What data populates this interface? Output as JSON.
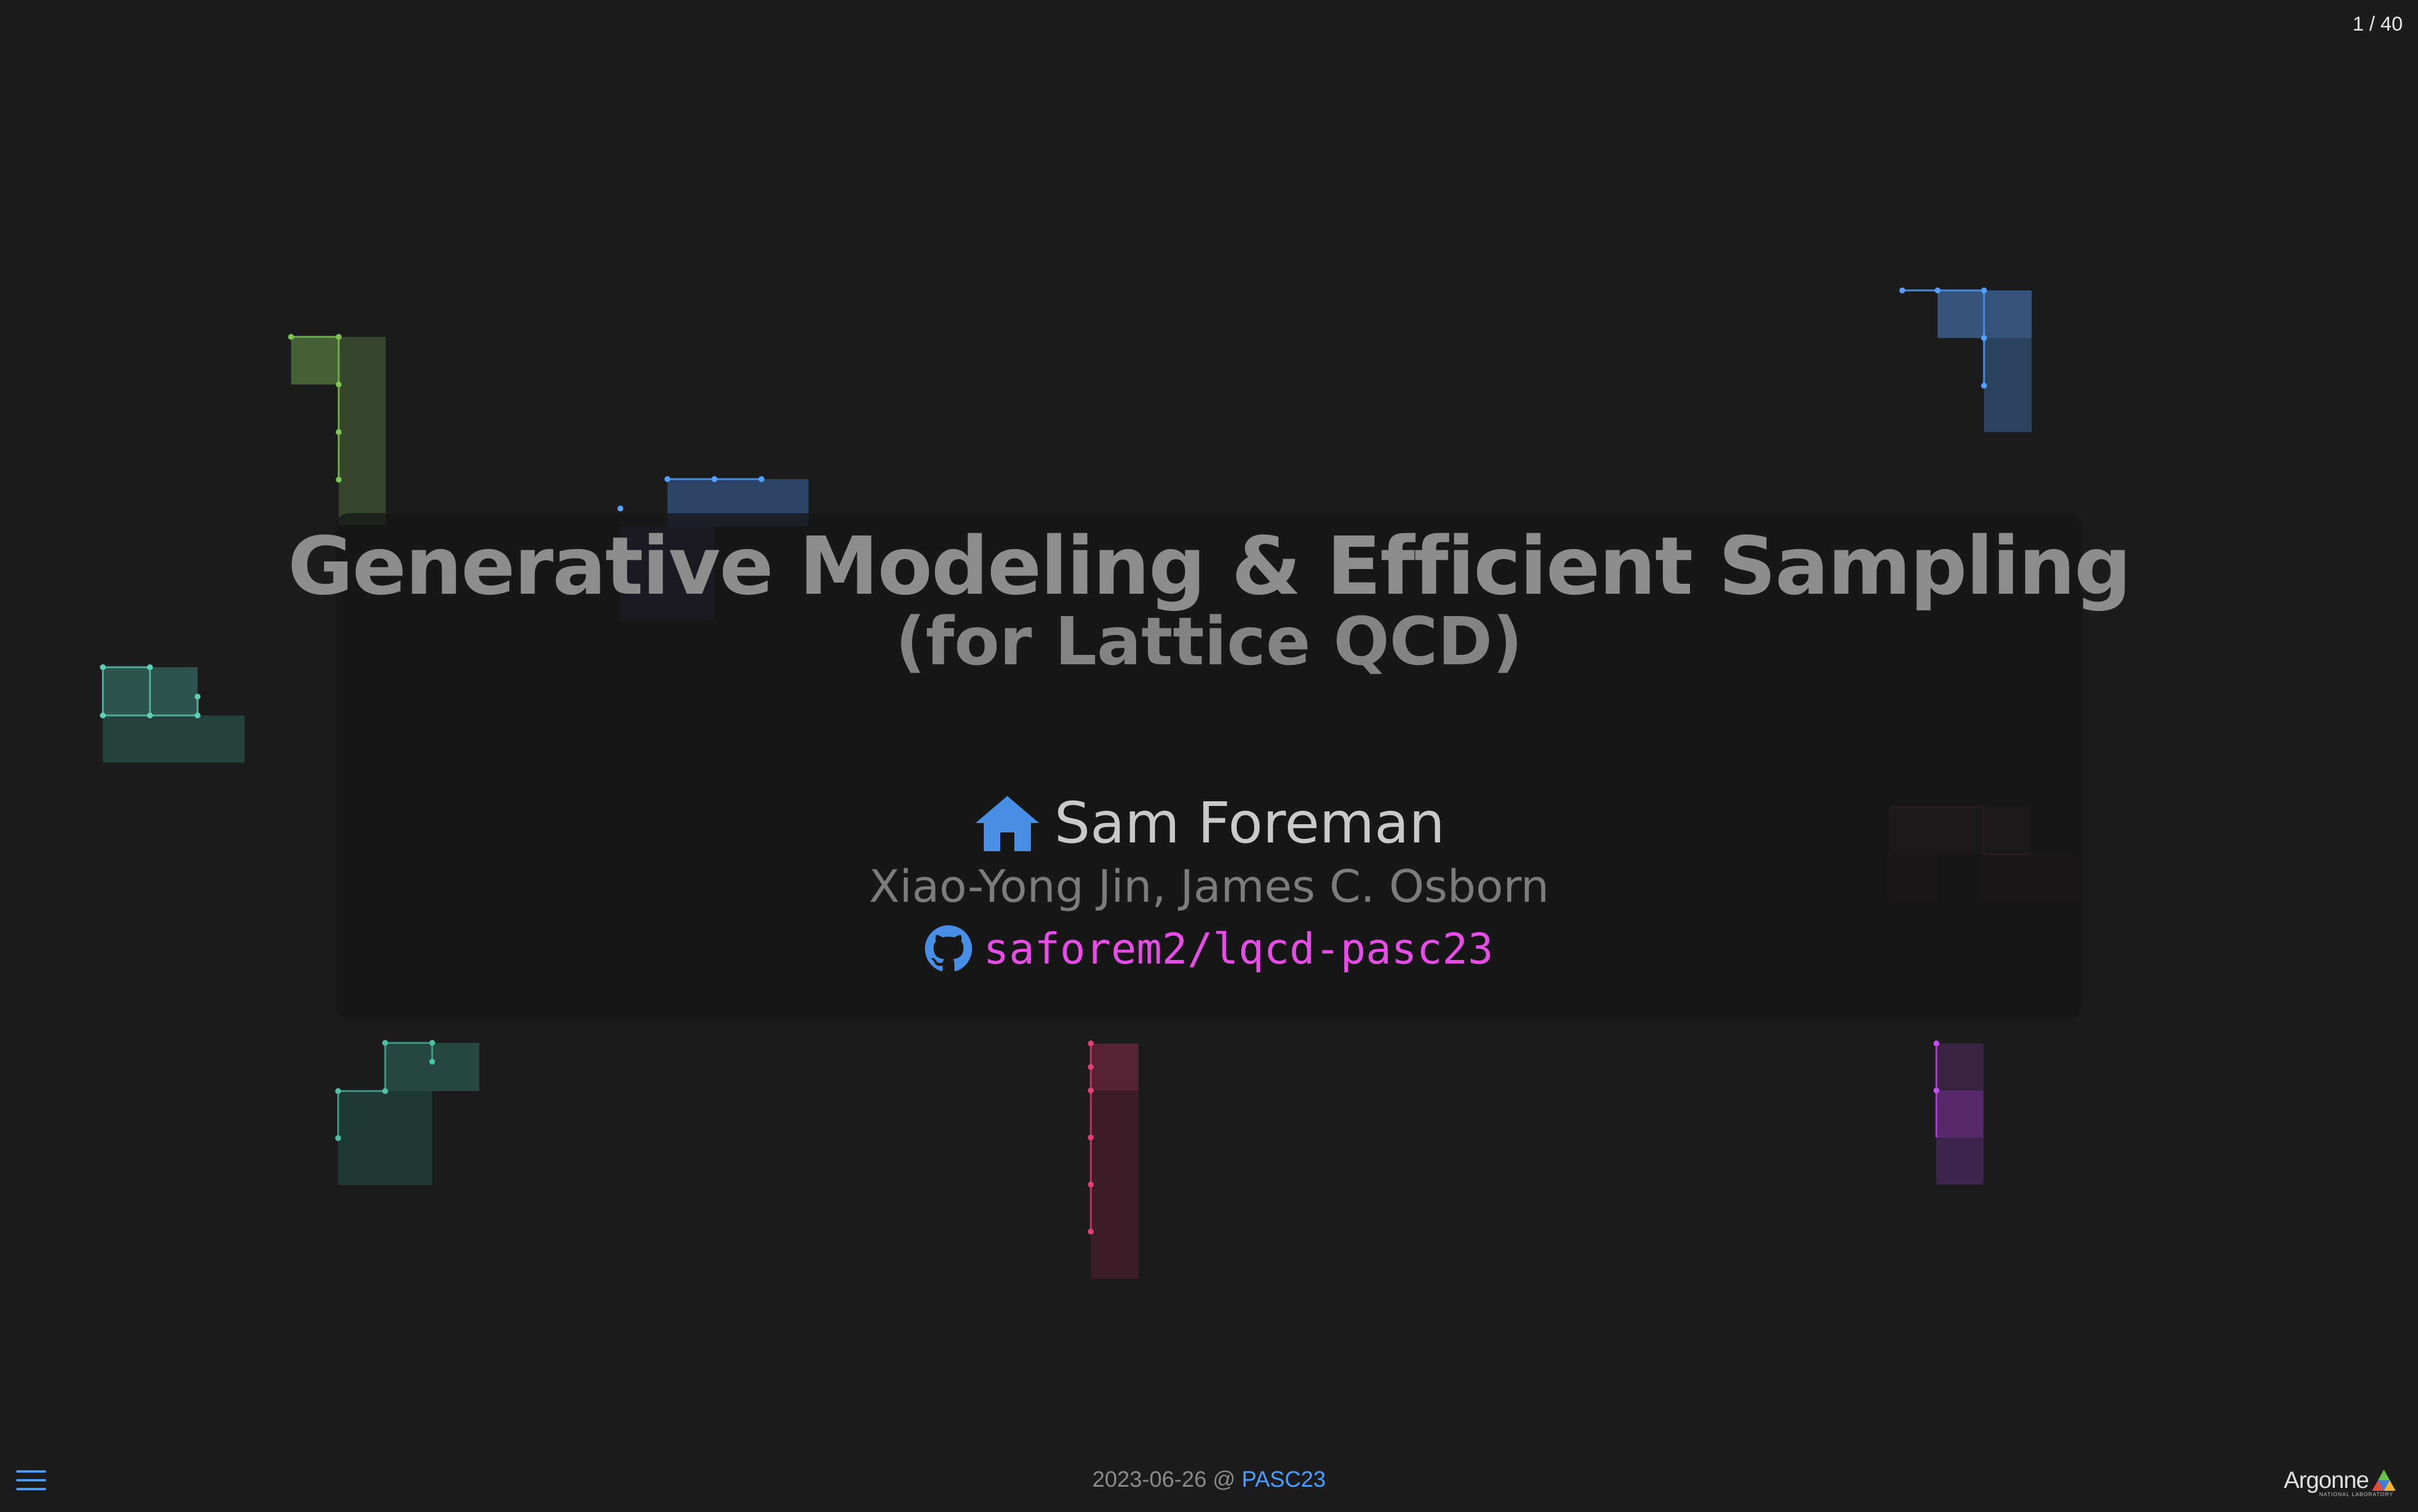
{
  "slide": {
    "counter": "1 / 40",
    "title": "Generative Modeling & Efficient Sampling",
    "subtitle": "(for Lattice QCD)",
    "author": "Sam Foreman",
    "coauthors": "Xiao-Yong Jin, James C. Osborn",
    "repo": "saforem2/lqcd-pasc23",
    "author_icon": "home-icon",
    "repo_icon": "github-icon"
  },
  "footer": {
    "date_prefix": "2023-06-26 @ ",
    "conference": "PASC23",
    "menu_icon": "hamburger-menu-icon"
  },
  "logo": {
    "name": "Argonne",
    "tagline": "NATIONAL LABORATORY"
  },
  "colors": {
    "background": "#1c1c1d",
    "accent_blue": "#4a9eff",
    "repo_magenta": "#e64de6"
  }
}
